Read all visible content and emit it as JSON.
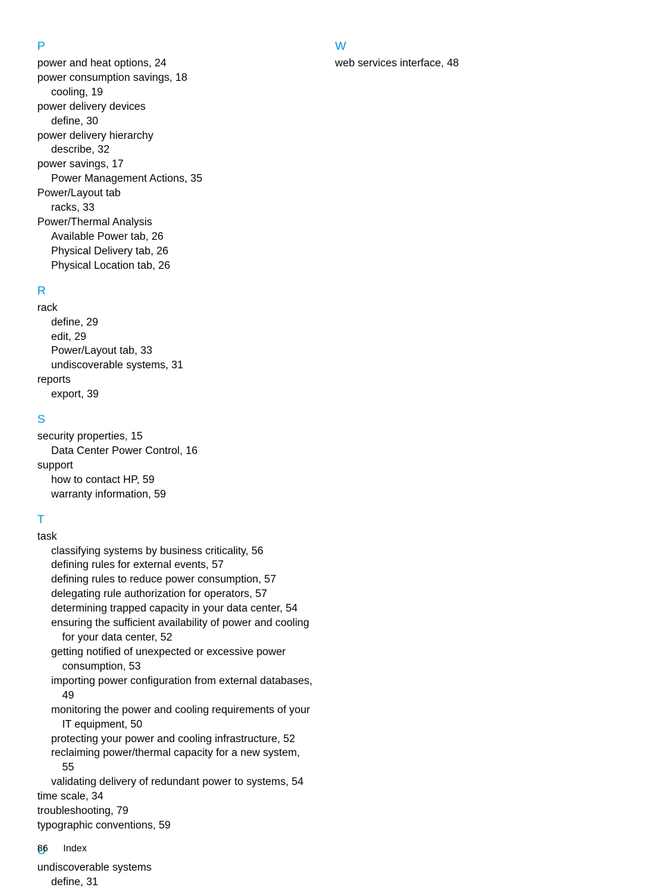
{
  "footer": {
    "page_number": "86",
    "section": "Index"
  },
  "sections": [
    {
      "letter": "P",
      "entries": [
        {
          "text": "power and heat options, 24",
          "indent": 0
        },
        {
          "text": "power consumption savings, 18",
          "indent": 0
        },
        {
          "text": "cooling, 19",
          "indent": 1
        },
        {
          "text": "power delivery devices",
          "indent": 0
        },
        {
          "text": "define, 30",
          "indent": 1
        },
        {
          "text": "power delivery hierarchy",
          "indent": 0
        },
        {
          "text": "describe, 32",
          "indent": 1
        },
        {
          "text": "power savings, 17",
          "indent": 0
        },
        {
          "text": "Power Management Actions, 35",
          "indent": 1
        },
        {
          "text": "Power/Layout tab",
          "indent": 0
        },
        {
          "text": "racks, 33",
          "indent": 1
        },
        {
          "text": "Power/Thermal Analysis",
          "indent": 0
        },
        {
          "text": "Available Power tab, 26",
          "indent": 1
        },
        {
          "text": "Physical Delivery tab, 26",
          "indent": 1
        },
        {
          "text": "Physical Location tab, 26",
          "indent": 1
        }
      ]
    },
    {
      "letter": "R",
      "entries": [
        {
          "text": "rack",
          "indent": 0
        },
        {
          "text": "define, 29",
          "indent": 1
        },
        {
          "text": "edit, 29",
          "indent": 1
        },
        {
          "text": "Power/Layout tab, 33",
          "indent": 1
        },
        {
          "text": "undiscoverable systems, 31",
          "indent": 1
        },
        {
          "text": "reports",
          "indent": 0
        },
        {
          "text": "export, 39",
          "indent": 1
        }
      ]
    },
    {
      "letter": "S",
      "entries": [
        {
          "text": "security properties, 15",
          "indent": 0
        },
        {
          "text": "Data Center Power Control, 16",
          "indent": 1
        },
        {
          "text": "support",
          "indent": 0
        },
        {
          "text": "how to contact HP, 59",
          "indent": 1
        },
        {
          "text": "warranty information, 59",
          "indent": 1
        }
      ]
    },
    {
      "letter": "T",
      "entries": [
        {
          "text": "task",
          "indent": 0
        },
        {
          "text": "classifying systems by business criticality, 56",
          "indent": 1
        },
        {
          "text": "defining rules for external events, 57",
          "indent": 1
        },
        {
          "text": "defining rules to reduce power consumption, 57",
          "indent": 1
        },
        {
          "text": "delegating rule authorization for operators, 57",
          "indent": 1
        },
        {
          "text": "determining trapped capacity in your data center, 54",
          "indent": 1
        },
        {
          "text": "ensuring the sufficient availability of power and cooling",
          "indent": 1
        },
        {
          "text": "for your data center, 52",
          "indent": 2
        },
        {
          "text": "getting notified of unexpected or excessive power",
          "indent": 1
        },
        {
          "text": "consumption, 53",
          "indent": 2
        },
        {
          "text": "importing power configuration from external databases,",
          "indent": 1
        },
        {
          "text": "49",
          "indent": 2
        },
        {
          "text": "monitoring the power and cooling requirements of your",
          "indent": 1
        },
        {
          "text": "IT equipment, 50",
          "indent": 2
        },
        {
          "text": "protecting your power and cooling infrastructure, 52",
          "indent": 1
        },
        {
          "text": "reclaiming power/thermal capacity for a new system,",
          "indent": 1
        },
        {
          "text": "55",
          "indent": 2
        },
        {
          "text": "validating delivery of redundant power to systems, 54",
          "indent": 1
        },
        {
          "text": "time scale, 34",
          "indent": 0
        },
        {
          "text": "troubleshooting, 79",
          "indent": 0
        },
        {
          "text": "typographic conventions, 59",
          "indent": 0
        }
      ]
    },
    {
      "letter": "U",
      "entries": [
        {
          "text": "undiscoverable systems",
          "indent": 0
        },
        {
          "text": "define, 31",
          "indent": 1
        }
      ]
    }
  ],
  "right_sections": [
    {
      "letter": "W",
      "entries": [
        {
          "text": "web services interface, 48",
          "indent": 0
        }
      ]
    }
  ]
}
